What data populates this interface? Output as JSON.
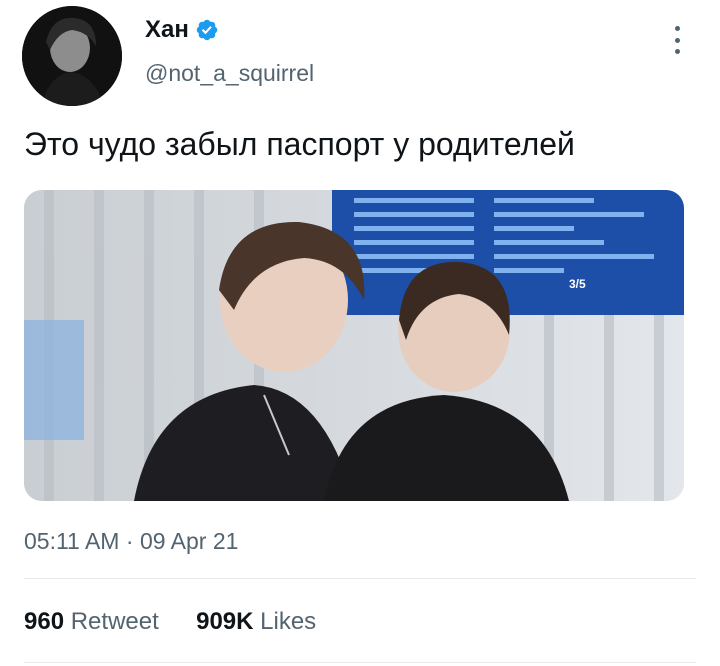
{
  "author": {
    "name": "Хан",
    "handle": "@not_a_squirrel",
    "verified": true,
    "avatar_icon": "avatar-photo"
  },
  "menu_icon": "more-vertical-icon",
  "tweet": {
    "text": "Это чудо забыл паспорт у родителей",
    "image_icon": "tweet-photo",
    "board_page": "3/5"
  },
  "meta": {
    "time": "05:11 AM",
    "separator": "·",
    "date": "09 Apr 21"
  },
  "stats": {
    "retweets_count": "960",
    "retweets_label": "Retweet",
    "likes_count": "909K",
    "likes_label": "Likes"
  },
  "colors": {
    "verified": "#1d9bf0",
    "text": "#0f1419",
    "secondary": "#536471",
    "divider": "#e6ecf0"
  }
}
